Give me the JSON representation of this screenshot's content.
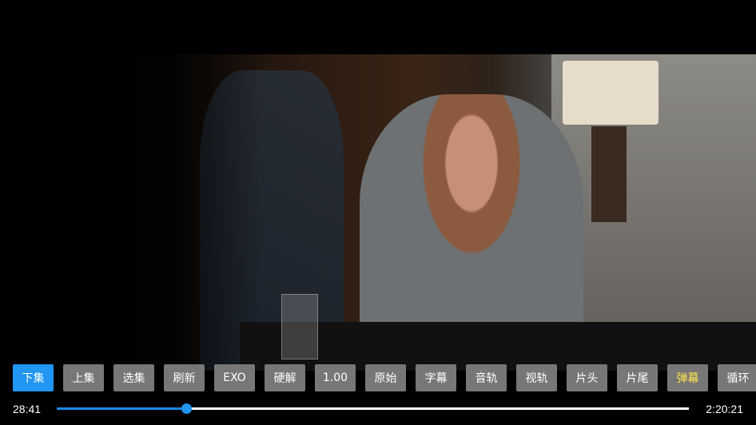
{
  "video": {
    "description_icon": "video-frame"
  },
  "buttons": [
    {
      "label": "下集",
      "active": true
    },
    {
      "label": "上集"
    },
    {
      "label": "选集"
    },
    {
      "label": "刷新"
    },
    {
      "label": "EXO"
    },
    {
      "label": "硬解"
    },
    {
      "label": "1.00"
    },
    {
      "label": "原始"
    },
    {
      "label": "字幕"
    },
    {
      "label": "音轨"
    },
    {
      "label": "视轨"
    },
    {
      "label": "片头"
    },
    {
      "label": "片尾"
    },
    {
      "label": "弹幕",
      "highlight": true
    },
    {
      "label": "循环"
    }
  ],
  "progress": {
    "current": "28:41",
    "total": "2:20:21",
    "fraction": 0.2044
  },
  "colors": {
    "accent": "#2196f3",
    "button_bg": "#777777",
    "danmaku": "#ffe44d"
  }
}
